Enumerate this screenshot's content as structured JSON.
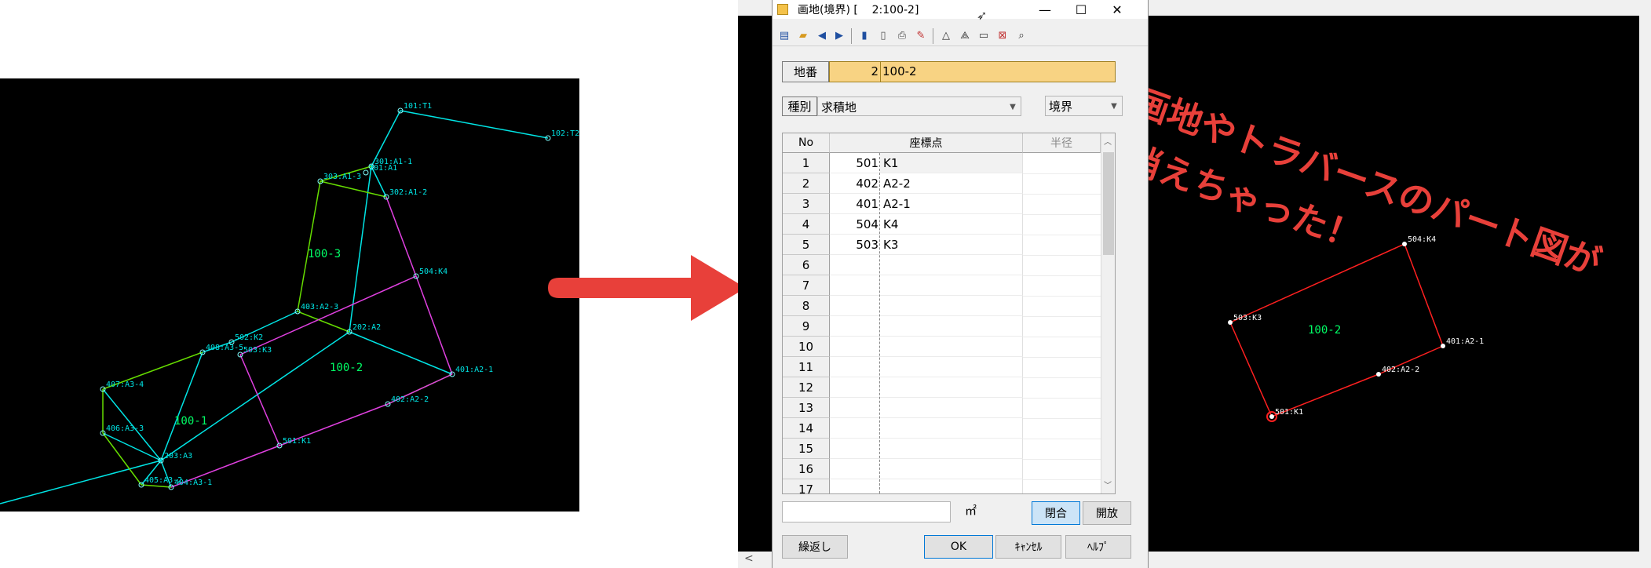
{
  "left_map": {
    "nodes": [
      {
        "id": "n101",
        "label": "101:T1"
      },
      {
        "id": "n102",
        "label": "102:T2"
      },
      {
        "id": "n301",
        "label": "301:A1-1"
      },
      {
        "id": "n201",
        "label": "201:A1"
      },
      {
        "id": "n303",
        "label": "303:A1-3"
      },
      {
        "id": "n302",
        "label": "302:A1-2"
      },
      {
        "id": "n504",
        "label": "504:K4"
      },
      {
        "id": "n403",
        "label": "403:A2-3"
      },
      {
        "id": "n202",
        "label": "202:A2"
      },
      {
        "id": "n502",
        "label": "502:K2"
      },
      {
        "id": "n408",
        "label": "408:A3-5"
      },
      {
        "id": "n503",
        "label": "503:K3"
      },
      {
        "id": "n401",
        "label": "401:A2-1"
      },
      {
        "id": "n402",
        "label": "402:A2-2"
      },
      {
        "id": "n407",
        "label": "407:A3-4"
      },
      {
        "id": "n406",
        "label": "406:A3-3"
      },
      {
        "id": "n501",
        "label": "501:K1"
      },
      {
        "id": "n203",
        "label": "203:A3"
      },
      {
        "id": "n405",
        "label": "405:A3-2"
      },
      {
        "id": "n404",
        "label": "404:A3-1"
      }
    ],
    "parcel_labels": [
      "100-3",
      "100-2",
      "100-1"
    ],
    "colors": {
      "traverse": "#00e5e5",
      "parcel_100_2": "#e040e0",
      "parcel_other": "#66dd00",
      "label": "#00ff66"
    }
  },
  "dialog": {
    "title": "画地(境界) [    2:100-2]",
    "window_buttons": {
      "minimize": "—",
      "maximize": "☐",
      "close": "✕"
    },
    "chiban": {
      "label": "地番",
      "num": "2",
      "value": "100-2"
    },
    "shubetsu": {
      "label": "種別",
      "value": "求積地"
    },
    "kind_select": {
      "value": "境界"
    },
    "table": {
      "headers": [
        "No",
        "座標点",
        "半径"
      ],
      "rows": [
        {
          "no": "1",
          "num": "501",
          "name": "K1"
        },
        {
          "no": "2",
          "num": "402",
          "name": "A2-2"
        },
        {
          "no": "3",
          "num": "401",
          "name": "A2-1"
        },
        {
          "no": "4",
          "num": "504",
          "name": "K4"
        },
        {
          "no": "5",
          "num": "503",
          "name": "K3"
        },
        {
          "no": "6",
          "num": "",
          "name": ""
        },
        {
          "no": "7",
          "num": "",
          "name": ""
        },
        {
          "no": "8",
          "num": "",
          "name": ""
        },
        {
          "no": "9",
          "num": "",
          "name": ""
        },
        {
          "no": "10",
          "num": "",
          "name": ""
        },
        {
          "no": "11",
          "num": "",
          "name": ""
        },
        {
          "no": "12",
          "num": "",
          "name": ""
        },
        {
          "no": "13",
          "num": "",
          "name": ""
        },
        {
          "no": "14",
          "num": "",
          "name": ""
        },
        {
          "no": "15",
          "num": "",
          "name": ""
        },
        {
          "no": "16",
          "num": "",
          "name": ""
        },
        {
          "no": "17",
          "num": "",
          "name": ""
        }
      ]
    },
    "area_unit": "㎡",
    "buttons": {
      "close_shape": "閉合",
      "open_shape": "開放",
      "repeat": "繰返し",
      "ok": "OK",
      "cancel": "ｷｬﾝｾﾙ",
      "help": "ﾍﾙﾌﾟ"
    }
  },
  "annotation": {
    "line1": "画地やトラバースのパート図が",
    "line2": "消えちゃった！",
    "color": "#e8403a"
  },
  "right_map": {
    "nodes": [
      {
        "id": "r504",
        "label": "504:K4"
      },
      {
        "id": "r503",
        "label": "503:K3"
      },
      {
        "id": "r401",
        "label": "401:A2-1"
      },
      {
        "id": "r402",
        "label": "402:A2-2"
      },
      {
        "id": "r501",
        "label": "501:K1"
      }
    ],
    "parcel_label": "100-2",
    "colors": {
      "outline": "#ff2020",
      "label": "#00ff66"
    }
  }
}
